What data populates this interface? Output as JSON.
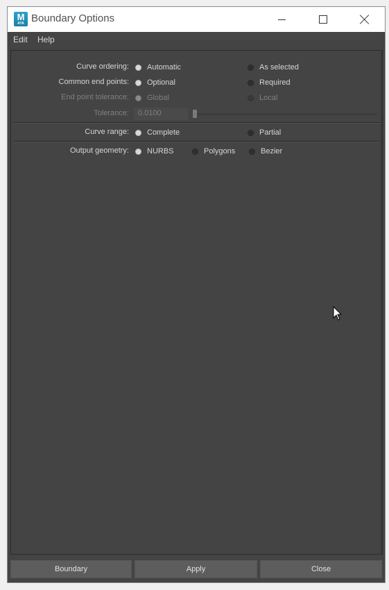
{
  "window": {
    "title": "Boundary Options",
    "app_icon": {
      "letter": "M",
      "sub": "AYA"
    }
  },
  "menu": {
    "edit": "Edit",
    "help": "Help"
  },
  "options": {
    "curve_ordering": {
      "label": "Curve ordering:",
      "opt1": "Automatic",
      "opt2": "As selected",
      "selected": "Automatic"
    },
    "common_end_points": {
      "label": "Common end points:",
      "opt1": "Optional",
      "opt2": "Required",
      "selected": "Optional"
    },
    "end_point_tolerance": {
      "label": "End point tolerance:",
      "opt1": "Global",
      "opt2": "Local",
      "selected": "Global",
      "disabled": true
    },
    "tolerance": {
      "label": "Tolerance:",
      "value": "0.0100",
      "disabled": true
    },
    "curve_range": {
      "label": "Curve range:",
      "opt1": "Complete",
      "opt2": "Partial",
      "selected": "Complete"
    },
    "output_geometry": {
      "label": "Output geometry:",
      "opt1": "NURBS",
      "opt2": "Polygons",
      "opt3": "Bezier",
      "selected": "NURBS"
    }
  },
  "buttons": {
    "boundary": "Boundary",
    "apply": "Apply",
    "close": "Close"
  },
  "icons": {
    "minimize": "minimize-icon",
    "maximize": "maximize-icon",
    "close": "close-icon",
    "cursor": "mouse-pointer-icon"
  }
}
